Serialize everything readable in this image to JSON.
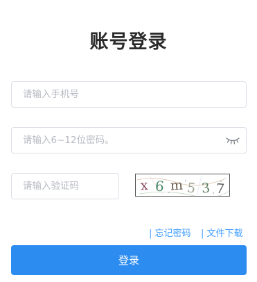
{
  "login": {
    "title": "账号登录",
    "phone_placeholder": "请输入手机号",
    "password_placeholder": "请输入6~12位密码。",
    "code_placeholder": "请输入验证码",
    "captcha_text": "x6m537",
    "captcha_chars": [
      "x",
      "6",
      "m",
      "5",
      "3",
      "7"
    ],
    "forgot_password": "| 忘记密码",
    "file_download": "| 文件下载",
    "submit_label": "登录",
    "icons": {
      "password_toggle": "eye-closed-icon"
    },
    "colors": {
      "primary": "#2d8cf0",
      "link": "#409eff",
      "border": "#dcdfe6",
      "placeholder": "#b7bac2"
    }
  }
}
